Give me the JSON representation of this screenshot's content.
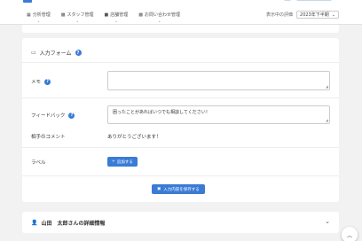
{
  "nav": {
    "items": [
      {
        "icon": "grid-icon",
        "glyph": "▦",
        "label": "分析管理"
      },
      {
        "icon": "staff-icon",
        "glyph": "▩",
        "label": "スタッフ管理"
      },
      {
        "icon": "store-icon",
        "glyph": "■",
        "label": "店舗管理"
      },
      {
        "icon": "inquiry-icon",
        "glyph": "▩",
        "label": "お問い合わせ管理"
      }
    ],
    "chevron": "⌄"
  },
  "period": {
    "label": "表示中の評価",
    "value": "2023年下半期",
    "chevron": "⌄"
  },
  "form": {
    "title": "入力フォーム",
    "help_glyph": "?",
    "memo_label": "メモ",
    "memo_value": "",
    "feedback_label": "フィードバック",
    "feedback_value": "困ったことがあればいつでも相談してください！",
    "partner_comment_label": "相手のコメント",
    "partner_comment_value": "ありがとうございます！",
    "label_label": "ラベル",
    "add_button": "追加する",
    "add_glyph": "+",
    "save_button": "入力内容を保存する",
    "save_glyph": "▣",
    "resize_glyph": "◢"
  },
  "detail": {
    "title": "山田　太郎さんの詳細情報",
    "chevron": "⌄"
  },
  "scroll_top_glyph": "︿",
  "colors": {
    "accent": "#3a7bd5",
    "background": "#f2f2f2"
  }
}
